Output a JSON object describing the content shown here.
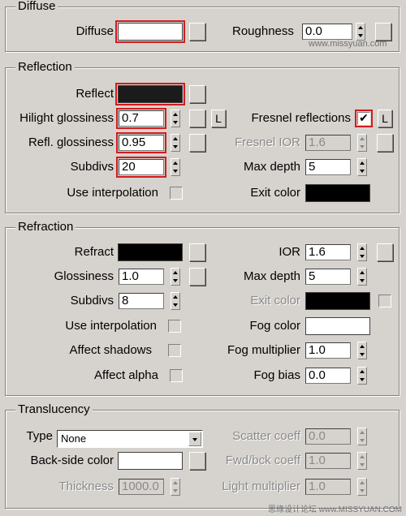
{
  "diffuse": {
    "title": "Diffuse",
    "diffuse_label": "Diffuse",
    "roughness_label": "Roughness",
    "roughness_value": "0.0",
    "diffuse_color": "#ffffff"
  },
  "reflection": {
    "title": "Reflection",
    "reflect_label": "Reflect",
    "reflect_color": "#1b1b1b",
    "hilight_label": "Hilight glossiness",
    "hilight_value": "0.7",
    "hilight_L": "L",
    "fresnel_label": "Fresnel reflections",
    "fresnel_checked": "✔",
    "fresnel_L": "L",
    "refl_gloss_label": "Refl. glossiness",
    "refl_gloss_value": "0.95",
    "fresnel_ior_label": "Fresnel IOR",
    "fresnel_ior_value": "1.6",
    "subdivs_label": "Subdivs",
    "subdivs_value": "20",
    "max_depth_label": "Max depth",
    "max_depth_value": "5",
    "use_interp_label": "Use interpolation",
    "exit_color_label": "Exit color",
    "exit_color": "#000000"
  },
  "refraction": {
    "title": "Refraction",
    "refract_label": "Refract",
    "refract_color": "#000000",
    "ior_label": "IOR",
    "ior_value": "1.6",
    "gloss_label": "Glossiness",
    "gloss_value": "1.0",
    "max_depth_label": "Max depth",
    "max_depth_value": "5",
    "subdivs_label": "Subdivs",
    "subdivs_value": "8",
    "exit_color_label": "Exit color",
    "exit_color": "#000000",
    "use_interp_label": "Use interpolation",
    "fog_color_label": "Fog color",
    "fog_color": "#ffffff",
    "affect_shadows_label": "Affect shadows",
    "fog_mult_label": "Fog multiplier",
    "fog_mult_value": "1.0",
    "affect_alpha_label": "Affect alpha",
    "fog_bias_label": "Fog bias",
    "fog_bias_value": "0.0"
  },
  "translucency": {
    "title": "Translucency",
    "type_label": "Type",
    "type_value": "None",
    "scatter_label": "Scatter coeff",
    "scatter_value": "0.0",
    "backside_label": "Back-side color",
    "backside_color": "#ffffff",
    "fwdbck_label": "Fwd/bck coeff",
    "fwdbck_value": "1.0",
    "thickness_label": "Thickness",
    "thickness_value": "1000.0",
    "light_mult_label": "Light multiplier",
    "light_mult_value": "1.0"
  },
  "watermark": {
    "top": "www.missyuan.com",
    "bottom": "思缘设计论坛 www.MISSYUAN.COM"
  }
}
